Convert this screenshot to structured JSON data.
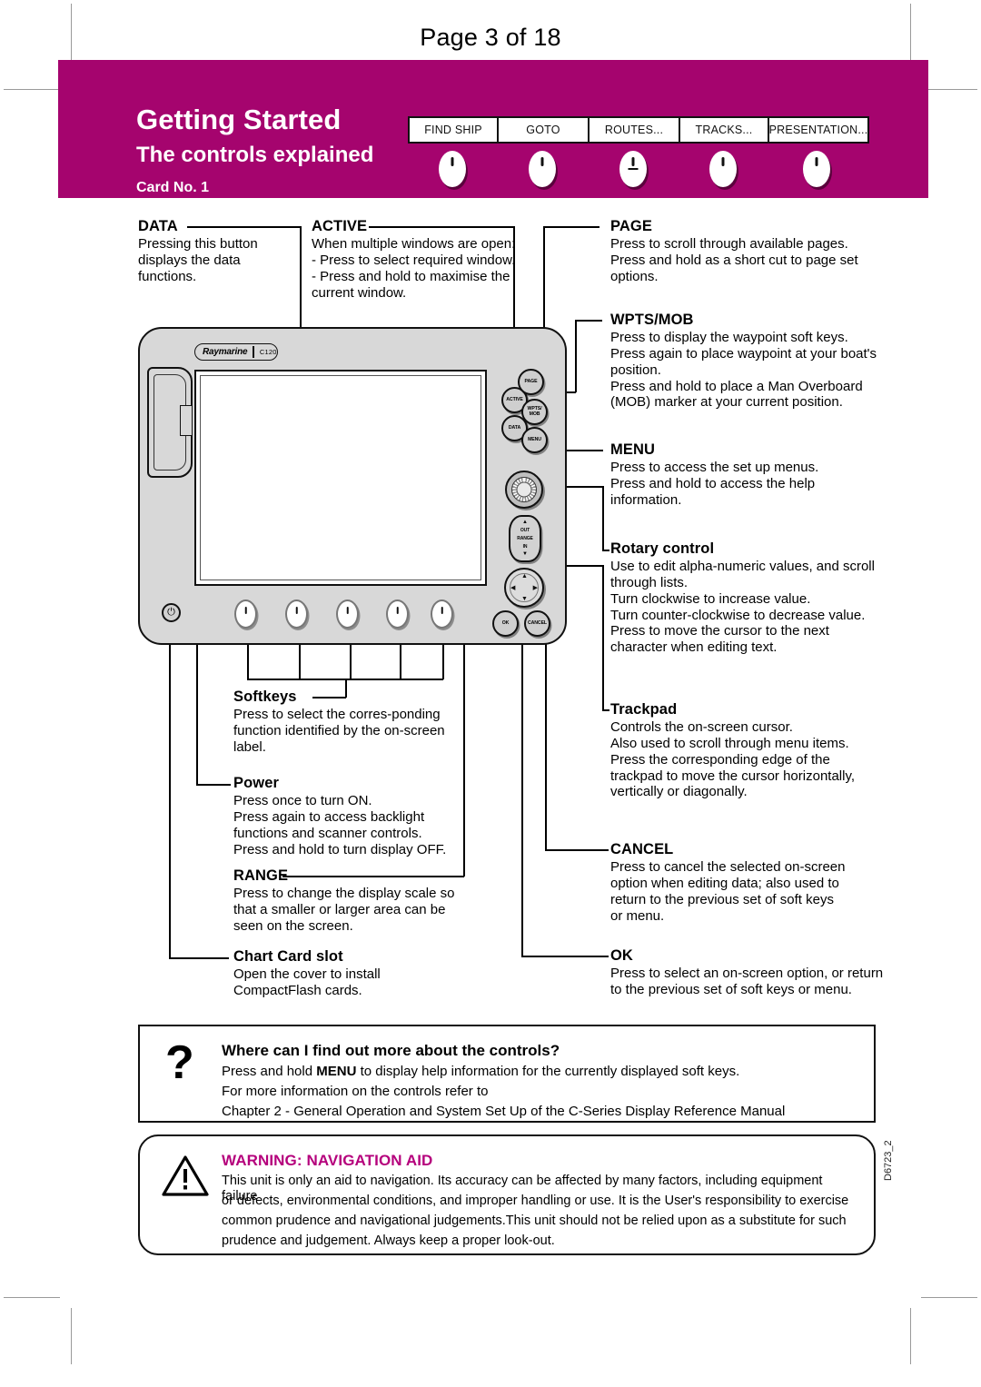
{
  "page": {
    "label": "Page 3 of 18"
  },
  "header": {
    "title": "Getting Started",
    "subtitle": "The controls explained",
    "card_no": "Card No. 1",
    "brand_color": "#a5046e",
    "softkeys": [
      {
        "label": "FIND SHIP"
      },
      {
        "label": "GOTO"
      },
      {
        "label": "ROUTES..."
      },
      {
        "label": "TRACKS..."
      },
      {
        "label": "PRESENTATION..."
      }
    ]
  },
  "device": {
    "brand": "Raymarine",
    "model": "C120",
    "keys": {
      "active": "ACTIVE",
      "data": "DATA",
      "page": "PAGE",
      "wpts_mob": "WPTS/ MOB",
      "menu": "MENU",
      "range_out": "OUT",
      "range_label": "RANGE",
      "range_in": "IN",
      "ok": "OK",
      "cancel": "CANCEL"
    }
  },
  "annotations": [
    {
      "id": "data",
      "title": "DATA",
      "lines": [
        "Pressing this button",
        "displays the data",
        "functions."
      ]
    },
    {
      "id": "active",
      "title": "ACTIVE",
      "lines": [
        "When multiple windows are open:",
        "- Press to select required window.",
        "- Press and hold to maximise the",
        "current window."
      ]
    },
    {
      "id": "page",
      "title": "PAGE",
      "lines": [
        "Press to scroll through available pages.",
        "Press and hold as a short cut to page set",
        "options."
      ]
    },
    {
      "id": "wpts-mob",
      "title": "WPTS/MOB",
      "lines": [
        "Press to display the waypoint soft keys.",
        "Press again to place waypoint at your boat's",
        "position.",
        "Press and hold to place a Man Overboard",
        "(MOB) marker at your current position."
      ]
    },
    {
      "id": "menu",
      "title": "MENU",
      "lines": [
        "Press to access the set up menus.",
        "Press and hold to access the help",
        "information."
      ]
    },
    {
      "id": "rotary-control",
      "title": "Rotary control",
      "lines": [
        "Use to edit alpha-numeric values, and scroll",
        "through lists.",
        "Turn clockwise to increase value.",
        "Turn counter-clockwise to decrease value.",
        "Press to move the cursor to the next",
        "character when editing text."
      ]
    },
    {
      "id": "softkeys",
      "title": "Softkeys",
      "lines": [
        "Press to select the corres-ponding",
        "function identified by the on-screen",
        "label."
      ]
    },
    {
      "id": "power",
      "title": "Power",
      "lines": [
        "Press once to turn ON.",
        "Press again to access backlight",
        "functions and scanner controls.",
        "Press and hold to turn display OFF."
      ]
    },
    {
      "id": "range",
      "title": "RANGE",
      "lines": [
        "Press to change the display scale so",
        "that a smaller or larger area can be",
        "seen on the screen."
      ]
    },
    {
      "id": "chart-card-slot",
      "title": "Chart Card slot",
      "lines": [
        "Open the cover to install",
        "CompactFlash cards."
      ]
    },
    {
      "id": "trackpad",
      "title": "Trackpad",
      "lines": [
        "Controls the on-screen cursor.",
        "Also used to scroll through menu items.",
        "Press the corresponding edge of the",
        "trackpad to move the cursor horizontally,",
        "vertically or diagonally."
      ]
    },
    {
      "id": "cancel",
      "title": "CANCEL",
      "lines": [
        "Press to cancel the selected on-screen",
        "option when editing data; also used to",
        "return to the previous set of soft keys",
        "or menu."
      ]
    },
    {
      "id": "ok",
      "title": "OK",
      "lines": [
        "Press to select an on-screen option, or return",
        "to the previous set of soft keys or menu."
      ]
    }
  ],
  "info_box": {
    "icon": "question-mark",
    "title": "Where can I find out more about the controls?",
    "line1_a": "Press and hold ",
    "line1_b": "MENU",
    "line1_c": " to display help information for the currently displayed soft keys.",
    "line2": "For more information on the controls refer to",
    "line3": "Chapter 2 - General Operation and System Set Up of the C-Series Display Reference Manual"
  },
  "warning_box": {
    "icon": "warning-triangle",
    "title": "WARNING: NAVIGATION AID",
    "title_color": "#b5007c",
    "line1": "This unit is only an aid to navigation. Its accuracy can be affected by many factors, including equipment failure",
    "line2": "or defects, environmental conditions, and improper handling or use. It is the User's responsibility to exercise",
    "line3": "common prudence and navigational judgements.This unit should not be relied upon as a substitute for such",
    "line4": "prudence and judgement.  Always keep a proper look-out."
  },
  "doc_code": "D6723_2"
}
